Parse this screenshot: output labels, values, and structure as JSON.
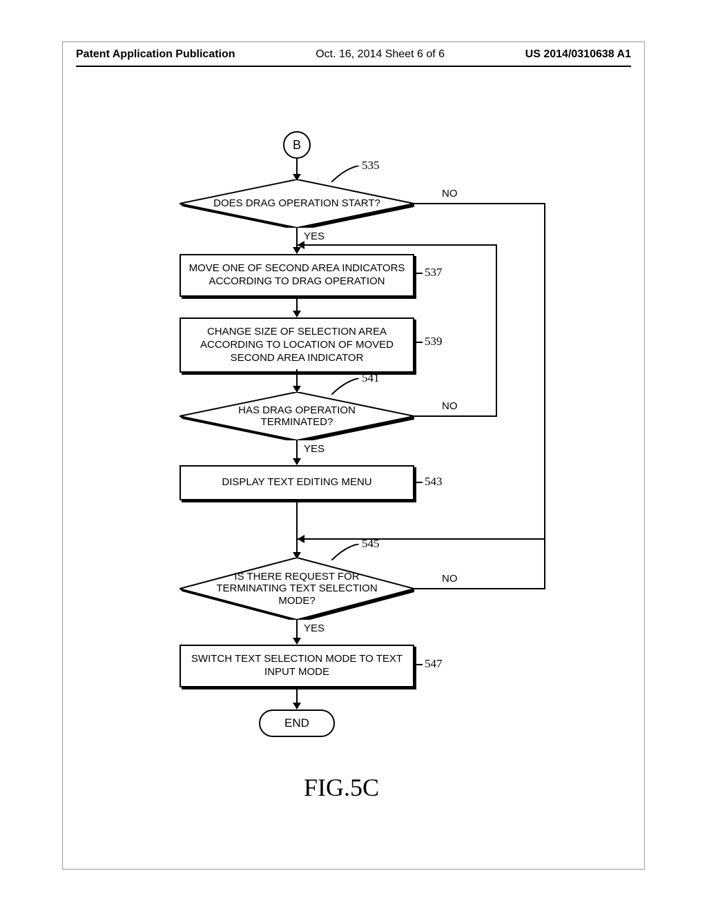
{
  "header": {
    "left": "Patent Application Publication",
    "center": "Oct. 16, 2014  Sheet 6 of 6",
    "right": "US 2014/0310638 A1"
  },
  "nodes": {
    "connector_b": "B",
    "d535": "DOES DRAG OPERATION START?",
    "p537": "MOVE ONE OF SECOND AREA INDICATORS ACCORDING TO DRAG OPERATION",
    "p539": "CHANGE SIZE OF SELECTION AREA ACCORDING TO LOCATION OF MOVED SECOND AREA INDICATOR",
    "d541": "HAS DRAG OPERATION TERMINATED?",
    "p543": "DISPLAY TEXT EDITING MENU",
    "d545": "IS THERE REQUEST FOR TERMINATING TEXT SELECTION MODE?",
    "p547": "SWITCH TEXT SELECTION MODE TO TEXT INPUT MODE",
    "end": "END"
  },
  "refs": {
    "r535": "535",
    "r537": "537",
    "r539": "539",
    "r541": "541",
    "r543": "543",
    "r545": "545",
    "r547": "547"
  },
  "labels": {
    "yes": "YES",
    "no": "NO"
  },
  "caption": "FIG.5C",
  "chart_data": {
    "type": "flowchart",
    "nodes": [
      {
        "id": "B",
        "type": "connector",
        "label": "B"
      },
      {
        "id": "535",
        "type": "decision",
        "label": "DOES DRAG OPERATION START?"
      },
      {
        "id": "537",
        "type": "process",
        "label": "MOVE ONE OF SECOND AREA INDICATORS ACCORDING TO DRAG OPERATION"
      },
      {
        "id": "539",
        "type": "process",
        "label": "CHANGE SIZE OF SELECTION AREA ACCORDING TO LOCATION OF MOVED SECOND AREA INDICATOR"
      },
      {
        "id": "541",
        "type": "decision",
        "label": "HAS DRAG OPERATION TERMINATED?"
      },
      {
        "id": "543",
        "type": "process",
        "label": "DISPLAY TEXT EDITING MENU"
      },
      {
        "id": "545",
        "type": "decision",
        "label": "IS THERE REQUEST FOR TERMINATING TEXT SELECTION MODE?"
      },
      {
        "id": "547",
        "type": "process",
        "label": "SWITCH TEXT SELECTION MODE TO TEXT INPUT MODE"
      },
      {
        "id": "END",
        "type": "terminator",
        "label": "END"
      }
    ],
    "edges": [
      {
        "from": "B",
        "to": "535"
      },
      {
        "from": "535",
        "to": "537",
        "label": "YES"
      },
      {
        "from": "535",
        "to": "545",
        "label": "NO",
        "route": "right-down-merge"
      },
      {
        "from": "537",
        "to": "539"
      },
      {
        "from": "539",
        "to": "541"
      },
      {
        "from": "541",
        "to": "543",
        "label": "YES"
      },
      {
        "from": "541",
        "to": "537",
        "label": "NO",
        "route": "right-up-left"
      },
      {
        "from": "543",
        "to": "545"
      },
      {
        "from": "545",
        "to": "547",
        "label": "YES"
      },
      {
        "from": "545",
        "to": "545-merge",
        "label": "NO",
        "route": "right-up-merge-535no"
      },
      {
        "from": "547",
        "to": "END"
      }
    ]
  }
}
